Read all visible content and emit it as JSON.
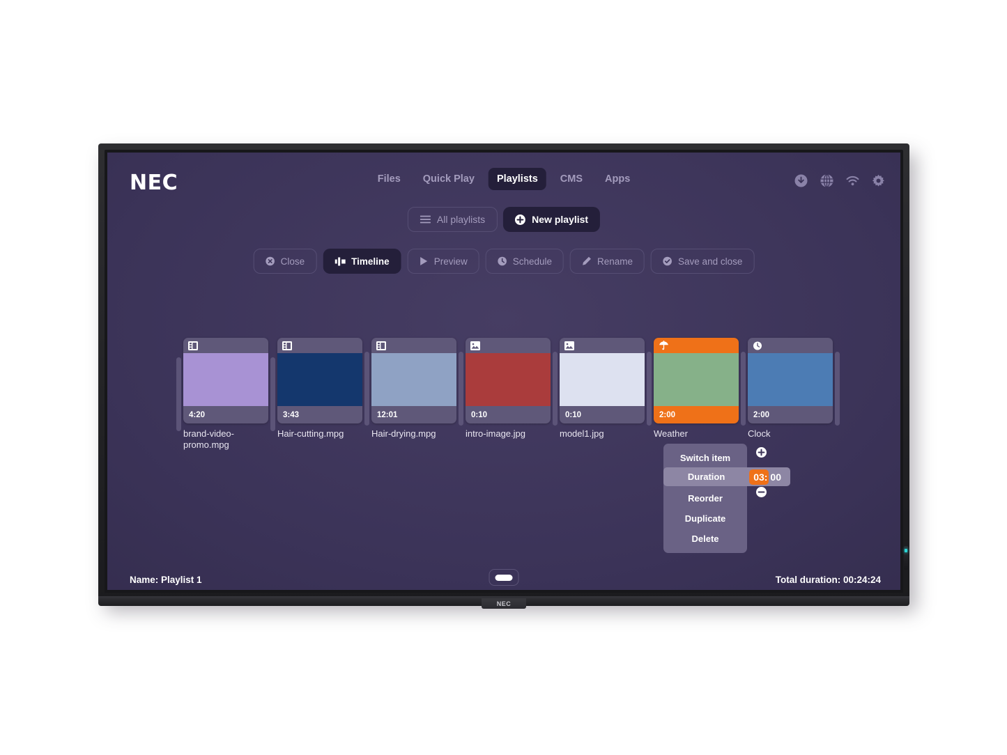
{
  "device": {
    "brand_logo": "NEC",
    "bezel_logo": "NEC"
  },
  "nav": {
    "items": [
      {
        "label": "Files",
        "active": false
      },
      {
        "label": "Quick Play",
        "active": false
      },
      {
        "label": "Playlists",
        "active": true
      },
      {
        "label": "CMS",
        "active": false
      },
      {
        "label": "Apps",
        "active": false
      }
    ],
    "icons": [
      {
        "name": "download-icon"
      },
      {
        "name": "globe-icon"
      },
      {
        "name": "wifi-icon"
      },
      {
        "name": "gear-icon"
      }
    ]
  },
  "playlist_header": {
    "all_playlists_label": "All playlists",
    "new_playlist_label": "New playlist"
  },
  "toolbar": {
    "buttons": [
      {
        "label": "Close",
        "icon": "close-circle-icon",
        "active": false
      },
      {
        "label": "Timeline",
        "icon": "timeline-icon",
        "active": true
      },
      {
        "label": "Preview",
        "icon": "play-icon",
        "active": false
      },
      {
        "label": "Schedule",
        "icon": "clock-icon",
        "active": false
      },
      {
        "label": "Rename",
        "icon": "pencil-icon",
        "active": false
      },
      {
        "label": "Save and close",
        "icon": "check-circle-icon",
        "active": false
      }
    ]
  },
  "timeline": {
    "items": [
      {
        "name": "brand-video-promo.mpg",
        "duration": "4:20",
        "type_icon": "film-icon",
        "thumb_color": "#a892d4",
        "selected": false
      },
      {
        "name": "Hair-cutting.mpg",
        "duration": "3:43",
        "type_icon": "film-icon",
        "thumb_color": "#14376d",
        "selected": false
      },
      {
        "name": "Hair-drying.mpg",
        "duration": "12:01",
        "type_icon": "film-icon",
        "thumb_color": "#8fa2c4",
        "selected": false
      },
      {
        "name": "intro-image.jpg",
        "duration": "0:10",
        "type_icon": "image-icon",
        "thumb_color": "#aa3c3c",
        "selected": false
      },
      {
        "name": "model1.jpg",
        "duration": "0:10",
        "type_icon": "image-icon",
        "thumb_color": "#dde1f0",
        "selected": false
      },
      {
        "name": "Weather",
        "duration": "2:00",
        "type_icon": "umbrella-icon",
        "thumb_color": "#86b189",
        "selected": true
      },
      {
        "name": "Clock",
        "duration": "2:00",
        "type_icon": "clock-icon",
        "thumb_color": "#4c7cb4",
        "selected": false
      }
    ]
  },
  "context_menu": {
    "items": [
      {
        "label": "Switch item",
        "highlighted": false
      },
      {
        "label": "Duration",
        "highlighted": true
      },
      {
        "label": "Reorder",
        "highlighted": false
      },
      {
        "label": "Duplicate",
        "highlighted": false
      },
      {
        "label": "Delete",
        "highlighted": false
      }
    ],
    "duration_minutes": "03:",
    "duration_seconds": "00",
    "increment_icon": "plus-circle-icon",
    "decrement_icon": "minus-circle-icon"
  },
  "status_bar": {
    "name": "Name: Playlist 1",
    "total_duration": "Total duration: 00:24:24",
    "home_button": "home-indicator"
  },
  "colors": {
    "accent_orange": "#ef7118",
    "screen_purple": "#3b3358",
    "card_purple": "#5f5879",
    "menu_purple": "#6a6285",
    "nav_inactive": "#a49cbd"
  }
}
